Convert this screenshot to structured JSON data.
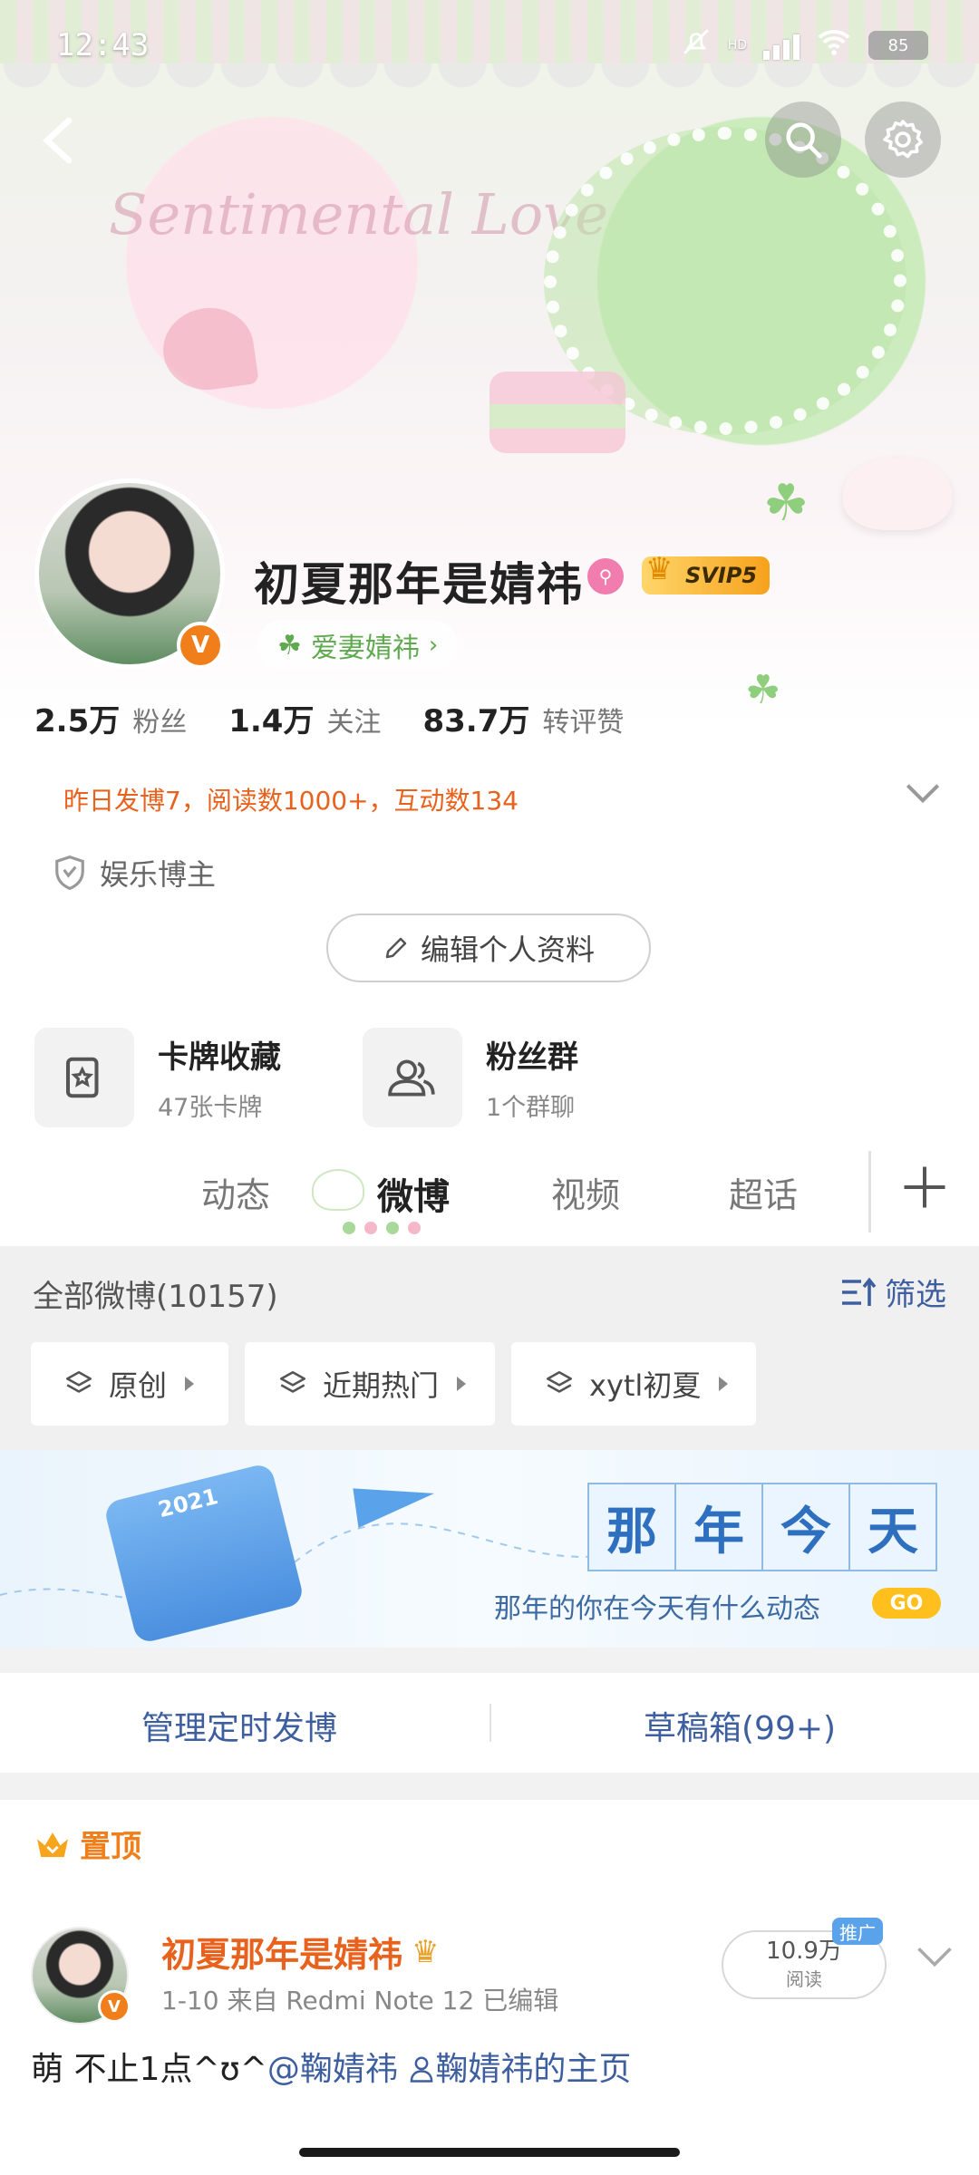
{
  "status_bar": {
    "time": "12:43",
    "network": "HD",
    "battery": "85"
  },
  "profile": {
    "username": "初夏那年是婧祎",
    "vip_label": "SVIP5",
    "relation_tag": "爱妻婧祎",
    "stats": [
      {
        "value": "2.5万",
        "label": "粉丝"
      },
      {
        "value": "1.4万",
        "label": "关注"
      },
      {
        "value": "83.7万",
        "label": "转评赞"
      }
    ],
    "activity_line": "昨日发博7，阅读数1000+，互动数134",
    "category": "娱乐博主",
    "edit_button": "编辑个人资料"
  },
  "cards": [
    {
      "title": "卡牌收藏",
      "subtitle": "47张卡牌",
      "icon": "card-star-icon"
    },
    {
      "title": "粉丝群",
      "subtitle": "1个群聊",
      "icon": "group-icon"
    }
  ],
  "tabs": [
    "动态",
    "微博",
    "视频",
    "超话"
  ],
  "active_tab": "微博",
  "filter": {
    "all_posts": "全部微博(10157)",
    "filter_label": "筛选",
    "chips": [
      "原创",
      "近期热门",
      "xytl初夏"
    ]
  },
  "memory_banner": {
    "year": "2021",
    "chars": [
      "那",
      "年",
      "今",
      "天"
    ],
    "subtitle": "那年的你在今天有什么动态",
    "go": "GO"
  },
  "manage": {
    "scheduled": "管理定时发博",
    "drafts": "草稿箱(99+)"
  },
  "pinned_post": {
    "pinned_label": "置顶",
    "author": "初夏那年是婧祎",
    "meta": "1-10  来自 Redmi Note 12  已编辑",
    "text_plain": "萌 不止1点^ʊ^",
    "mention1": "@鞠婧祎",
    "mention2": "鞠婧祎的主页",
    "reads": "10.9万",
    "reads_label": "阅读",
    "promo": "推广"
  },
  "colors": {
    "accent_orange": "#f07e1b",
    "link_blue": "#3d5f9f",
    "clover_green": "#5fa94e"
  }
}
